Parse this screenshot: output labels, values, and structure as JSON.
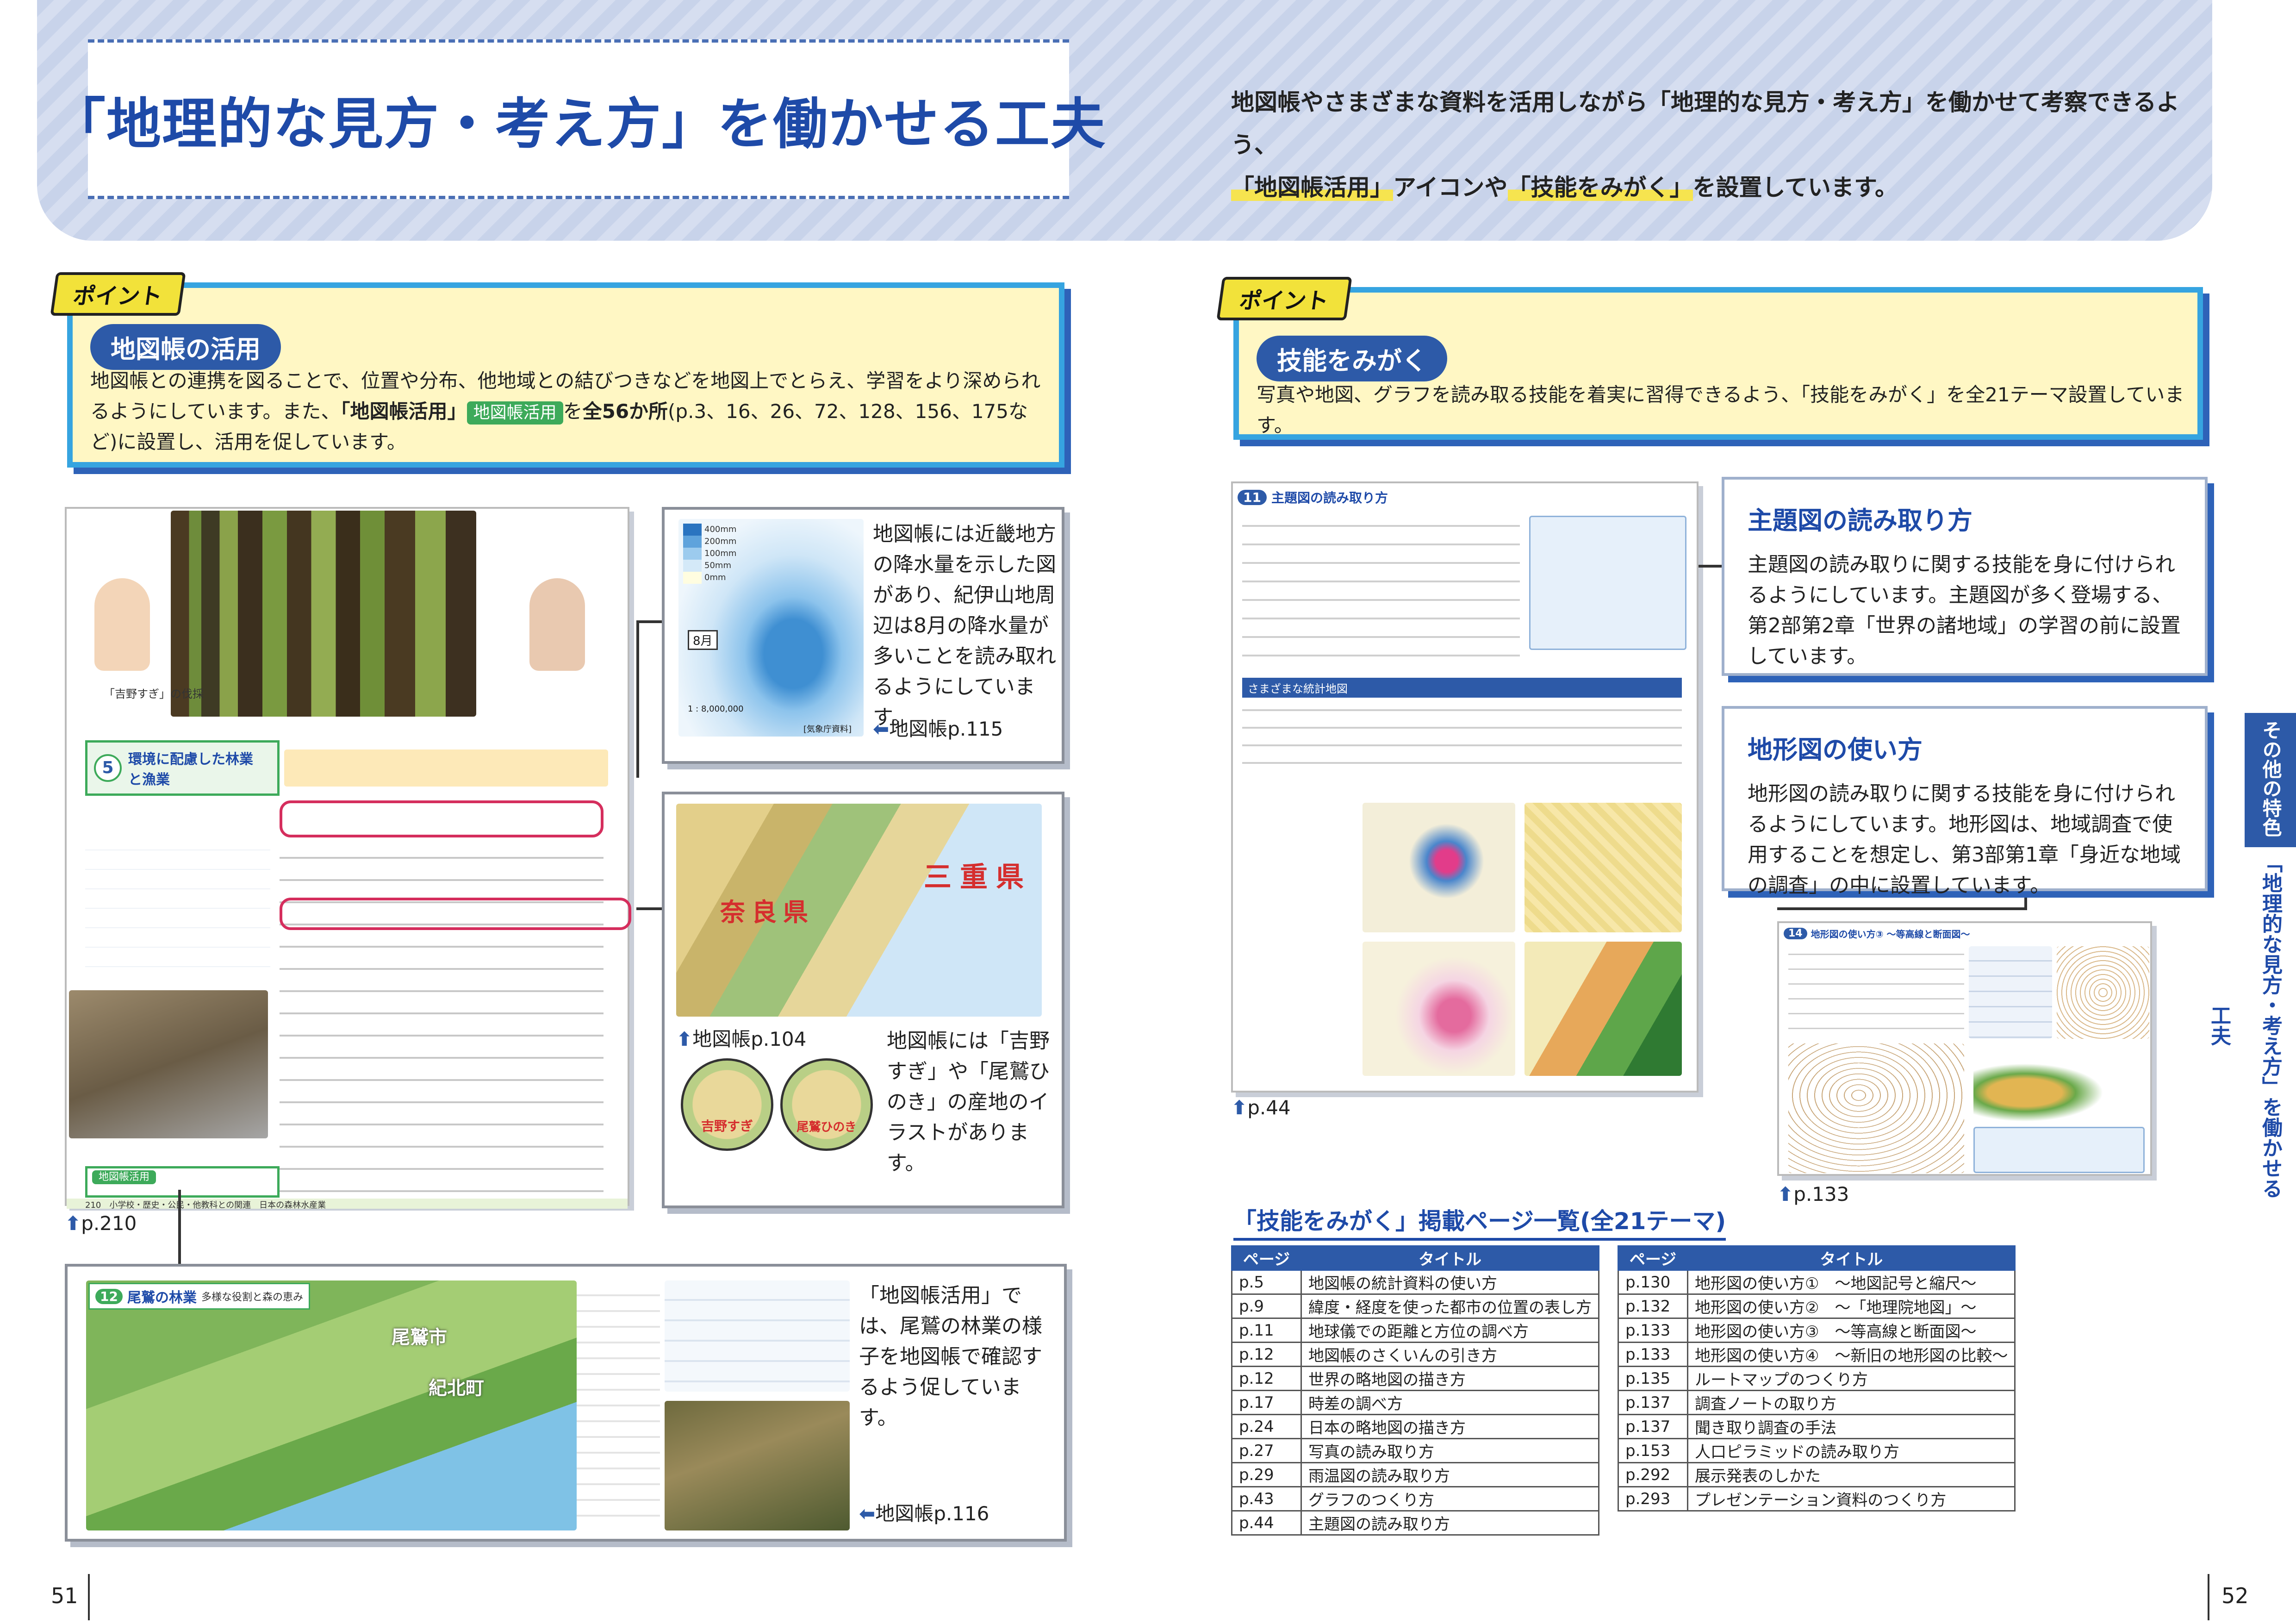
{
  "header": {
    "title": "「地理的な見方・考え方」を働かせる工夫",
    "intro_line1": "地図帳やさまざまな資料を活用しながら「地理的な見方・考え方」を働かせて考察できるよう、",
    "intro_hl1": "「地図帳活用」",
    "intro_mid": "アイコンや",
    "intro_hl2": "「技能をみがく」",
    "intro_end": "を設置しています。"
  },
  "left": {
    "point_tag": "ポイント",
    "heading": "地図帳の活用",
    "text1": "地図帳との連携を図ることで、位置や分布、他地域との結びつきなどを地図上でとらえ、学習をより深められるようにしています。また、",
    "text_bold": "「地図帳活用」",
    "tag_label": "地図帳活用",
    "text2": "を",
    "text_bold2": "全56か所",
    "text3": "(p.3、16、26、72、128、156、175など)に設置し、活用を促しています。",
    "textbook": {
      "title_num": "5",
      "title": "環境に配慮した林業と漁業",
      "caption": "「吉野すぎ」の伐採",
      "mini_tag": "地図帳活用",
      "footer": "210　小学校・歴史・公民・他教科との関連　日本の森林水産業",
      "page_ref": "p.210"
    },
    "map1": {
      "label_8": "8月",
      "legend": [
        "400mm",
        "200mm",
        "100mm",
        "50mm",
        "0mm"
      ],
      "scale": "1 : 8,000,000",
      "source": "[気象庁資料]",
      "desc": "地図帳には近畿地方の降水量を示した図があり、紀伊山地周辺は8月の降水量が多いことを読み取れるようにしています。",
      "page_ref": "地図帳p.115"
    },
    "map2": {
      "pref1": "三重県",
      "pref2": "奈良県",
      "circle1": "吉野すぎ",
      "circle2": "尾鷲ひのき",
      "page_ref": "地図帳p.104",
      "desc": "地図帳には「吉野すぎ」や「尾鷲ひのき」の産地のイラストがあります。"
    },
    "map3": {
      "num": "12",
      "title": "尾鷲の林業",
      "subtitle": "多様な役割と森の恵み",
      "town1": "尾鷲市",
      "town2": "紀北町",
      "desc": "「地図帳活用」では、尾鷲の林業の様子を地図帳で確認するよう促しています。",
      "page_ref": "地図帳p.116"
    }
  },
  "right": {
    "point_tag": "ポイント",
    "heading": "技能をみがく",
    "text": "写真や地図、グラフを読み取る技能を着実に習得できるよう、「技能をみがく」を全21テーマ設置しています。",
    "page1": {
      "num": "11",
      "title": "主題図の読み取り方",
      "sub": "さまざまな統計地図",
      "page_ref": "p.44"
    },
    "box1": {
      "title": "主題図の読み取り方",
      "text": "主題図の読み取りに関する技能を身に付けられるようにしています。主題図が多く登場する、第2部第2章「世界の諸地域」の学習の前に設置しています。"
    },
    "box2": {
      "title": "地形図の使い方",
      "text": "地形図の読み取りに関する技能を身に付けられるようにしています。地形図は、地域調査で使用することを想定し、第3部第1章「身近な地域の調査」の中に設置しています。"
    },
    "page2": {
      "num": "14",
      "title": "地形図の使い方③ 〜等高線と断面図〜",
      "page_ref": "p.133"
    },
    "list_title": "「技能をみがく」掲載ページ一覧(全21テーマ)",
    "col_page": "ページ",
    "col_title": "タイトル",
    "table1": [
      [
        "p.5",
        "地図帳の統計資料の使い方"
      ],
      [
        "p.9",
        "緯度・経度を使った都市の位置の表し方"
      ],
      [
        "p.11",
        "地球儀での距離と方位の調べ方"
      ],
      [
        "p.12",
        "地図帳のさくいんの引き方"
      ],
      [
        "p.12",
        "世界の略地図の描き方"
      ],
      [
        "p.17",
        "時差の調べ方"
      ],
      [
        "p.24",
        "日本の略地図の描き方"
      ],
      [
        "p.27",
        "写真の読み取り方"
      ],
      [
        "p.29",
        "雨温図の読み取り方"
      ],
      [
        "p.43",
        "グラフのつくり方"
      ],
      [
        "p.44",
        "主題図の読み取り方"
      ]
    ],
    "table2": [
      [
        "p.130",
        "地形図の使い方①　〜地図記号と縮尺〜"
      ],
      [
        "p.132",
        "地形図の使い方②　〜「地理院地図」〜"
      ],
      [
        "p.133",
        "地形図の使い方③　〜等高線と断面図〜"
      ],
      [
        "p.133",
        "地形図の使い方④　〜新旧の地形図の比較〜"
      ],
      [
        "p.135",
        "ルートマップのつくり方"
      ],
      [
        "p.137",
        "調査ノートの取り方"
      ],
      [
        "p.137",
        "聞き取り調査の手法"
      ],
      [
        "p.153",
        "人口ピラミッドの読み取り方"
      ],
      [
        "p.292",
        "展示発表のしかた"
      ],
      [
        "p.293",
        "プレゼンテーション資料のつくり方"
      ]
    ]
  },
  "side_tab": {
    "line1": "その他の特色",
    "line2": "「地理的な見方・考え方」を働かせる工夫"
  },
  "page_left": "51",
  "page_right": "52"
}
